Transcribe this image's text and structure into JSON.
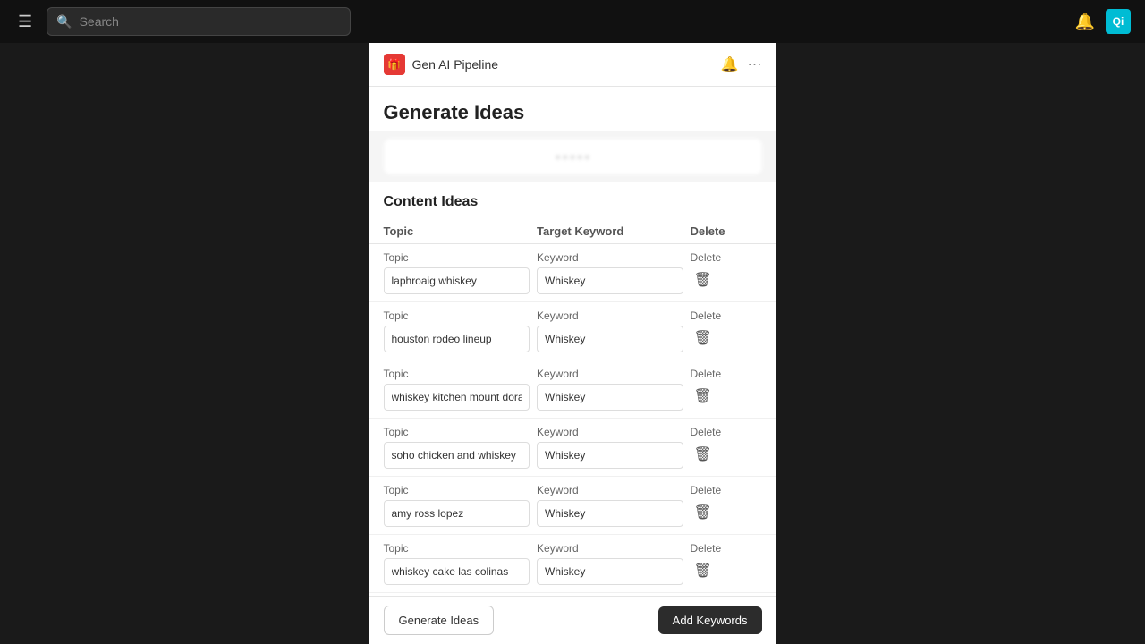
{
  "nav": {
    "hamburger": "☰",
    "search_placeholder": "Search",
    "bell": "🔔",
    "avatar_text": "Qi"
  },
  "app_header": {
    "icon": "🎁",
    "title": "Gen AI Pipeline",
    "bell": "🔔",
    "more": "•••"
  },
  "page": {
    "title": "Generate Ideas"
  },
  "faded_text": "• • • • •",
  "content_ideas": {
    "section_title": "Content Ideas",
    "columns": {
      "topic": "Topic",
      "keyword": "Target Keyword",
      "delete": "Delete"
    },
    "rows": [
      {
        "topic_label": "Topic",
        "topic_value": "laphroaig whiskey",
        "keyword_label": "Keyword",
        "keyword_value": "Whiskey",
        "delete_label": "Delete"
      },
      {
        "topic_label": "Topic",
        "topic_value": "houston rodeo lineup",
        "keyword_label": "Keyword",
        "keyword_value": "Whiskey",
        "delete_label": "Delete"
      },
      {
        "topic_label": "Topic",
        "topic_value": "whiskey kitchen mount dora",
        "keyword_label": "Keyword",
        "keyword_value": "Whiskey",
        "delete_label": "Delete"
      },
      {
        "topic_label": "Topic",
        "topic_value": "soho chicken and whiskey",
        "keyword_label": "Keyword",
        "keyword_value": "Whiskey",
        "delete_label": "Delete"
      },
      {
        "topic_label": "Topic",
        "topic_value": "amy ross lopez",
        "keyword_label": "Keyword",
        "keyword_value": "Whiskey",
        "delete_label": "Delete"
      },
      {
        "topic_label": "Topic",
        "topic_value": "whiskey cake las colinas",
        "keyword_label": "Keyword",
        "keyword_value": "Whiskey",
        "delete_label": "Delete"
      }
    ]
  },
  "bottom_bar": {
    "generate_label": "Generate Ideas",
    "add_keywords_label": "Add Keywords"
  }
}
